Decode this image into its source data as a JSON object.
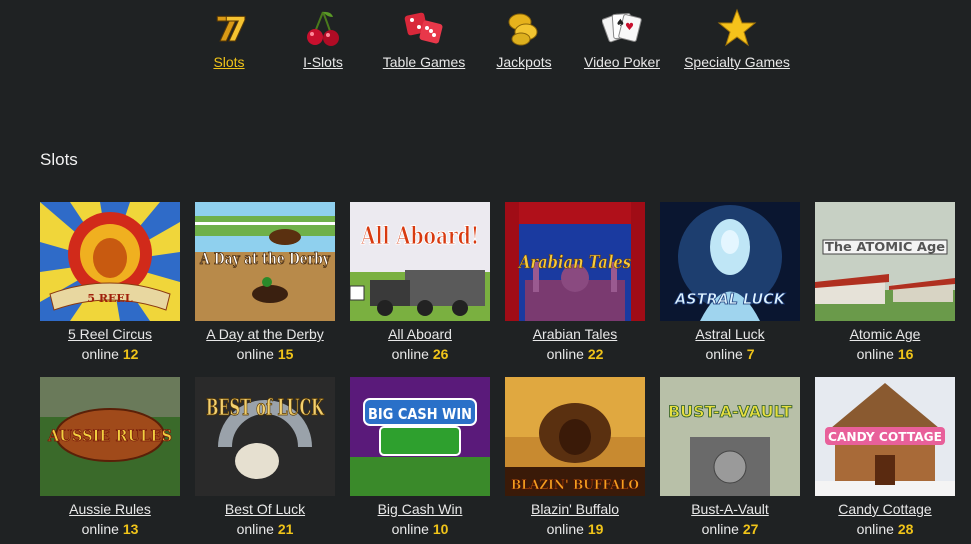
{
  "nav": [
    {
      "label": "Slots",
      "icon": "lucky-seven-icon",
      "active": true
    },
    {
      "label": "I-Slots",
      "icon": "cherries-icon",
      "active": false
    },
    {
      "label": "Table Games",
      "icon": "dice-icon",
      "active": false
    },
    {
      "label": "Jackpots",
      "icon": "gold-coins-icon",
      "active": false
    },
    {
      "label": "Video Poker",
      "icon": "playing-cards-icon",
      "active": false
    },
    {
      "label": "Specialty Games",
      "icon": "star-icon",
      "active": false
    }
  ],
  "section": {
    "title": "Slots"
  },
  "online_prefix": "online",
  "colors": {
    "background": "#1f2223",
    "accent": "#f0c419",
    "text": "#e8e8e8"
  },
  "games": [
    {
      "name": "5 Reel Circus",
      "online": "12",
      "thumb_text": "5 REEL"
    },
    {
      "name": "A Day at the Derby",
      "online": "15",
      "thumb_text": "A Day at the Derby"
    },
    {
      "name": "All Aboard",
      "online": "26",
      "thumb_text": "All Aboard!"
    },
    {
      "name": "Arabian Tales",
      "online": "22",
      "thumb_text": "Arabian Tales"
    },
    {
      "name": "Astral Luck",
      "online": "7",
      "thumb_text": "ASTRAL LUCK"
    },
    {
      "name": "Atomic Age",
      "online": "16",
      "thumb_text": "The ATOMIC Age"
    },
    {
      "name": "Aussie Rules",
      "online": "13",
      "thumb_text": "AUSSIE RULES"
    },
    {
      "name": "Best Of Luck",
      "online": "21",
      "thumb_text": "BEST of LUCK"
    },
    {
      "name": "Big Cash Win",
      "online": "10",
      "thumb_text": "BIG CASH WIN"
    },
    {
      "name": "Blazin' Buffalo",
      "online": "19",
      "thumb_text": "BLAZIN' BUFFALO"
    },
    {
      "name": "Bust-A-Vault",
      "online": "27",
      "thumb_text": "BUST-A-VAULT"
    },
    {
      "name": "Candy Cottage",
      "online": "28",
      "thumb_text": "CANDY COTTAGE"
    }
  ]
}
